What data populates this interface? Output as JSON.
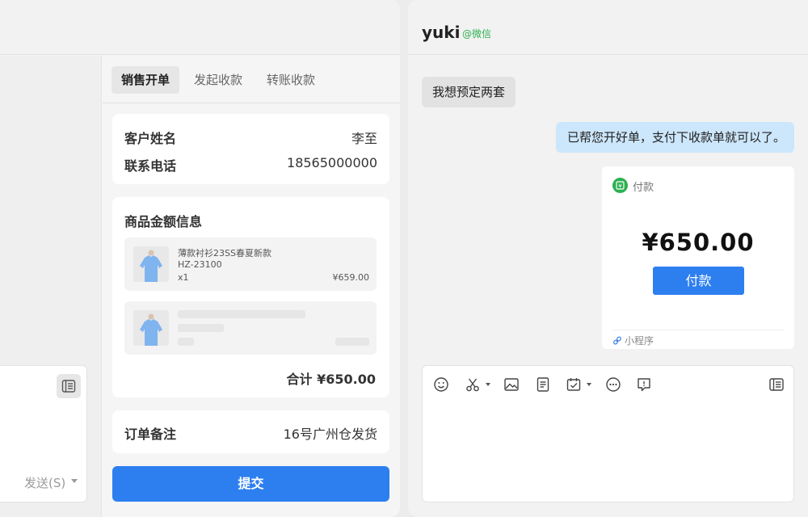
{
  "left": {
    "composer": {
      "send_label": "发送(S)"
    },
    "tabs": [
      {
        "label": "销售开单",
        "active": true
      },
      {
        "label": "发起收款",
        "active": false
      },
      {
        "label": "转账收款",
        "active": false
      }
    ],
    "customer": {
      "name_label": "客户姓名",
      "name_value": "李至",
      "phone_label": "联系电话",
      "phone_value": "18565000000"
    },
    "goods": {
      "title": "商品金额信息",
      "items": [
        {
          "name": "薄款衬衫23SS春夏新款",
          "code": "HZ-23100",
          "qty": "x1",
          "price": "¥659.00"
        }
      ],
      "total": "合计 ¥650.00"
    },
    "note": {
      "label": "订单备注",
      "value": "16号广州仓发货"
    },
    "submit_label": "提交"
  },
  "right": {
    "chat": {
      "name": "yuki",
      "tag": "@微信"
    },
    "messages": [
      {
        "direction": "in",
        "text": "我想预定两套"
      },
      {
        "direction": "out",
        "text": "已帮您开好单，支付下收款单就可以了。"
      }
    ],
    "pay_card": {
      "title": "付款",
      "amount": "¥650.00",
      "button": "付款",
      "footer": "小程序"
    },
    "toolbar_icons": [
      "emoji-icon",
      "scissors-icon",
      "image-icon",
      "document-icon",
      "task-icon",
      "more-icon",
      "chat-bubble-icon",
      "list-icon"
    ]
  },
  "colors": {
    "accent": "#2d7ff0",
    "wechat_green": "#2bb04f",
    "outgoing_bubble": "#cce6fb",
    "incoming_bubble": "#e2e2e2"
  }
}
